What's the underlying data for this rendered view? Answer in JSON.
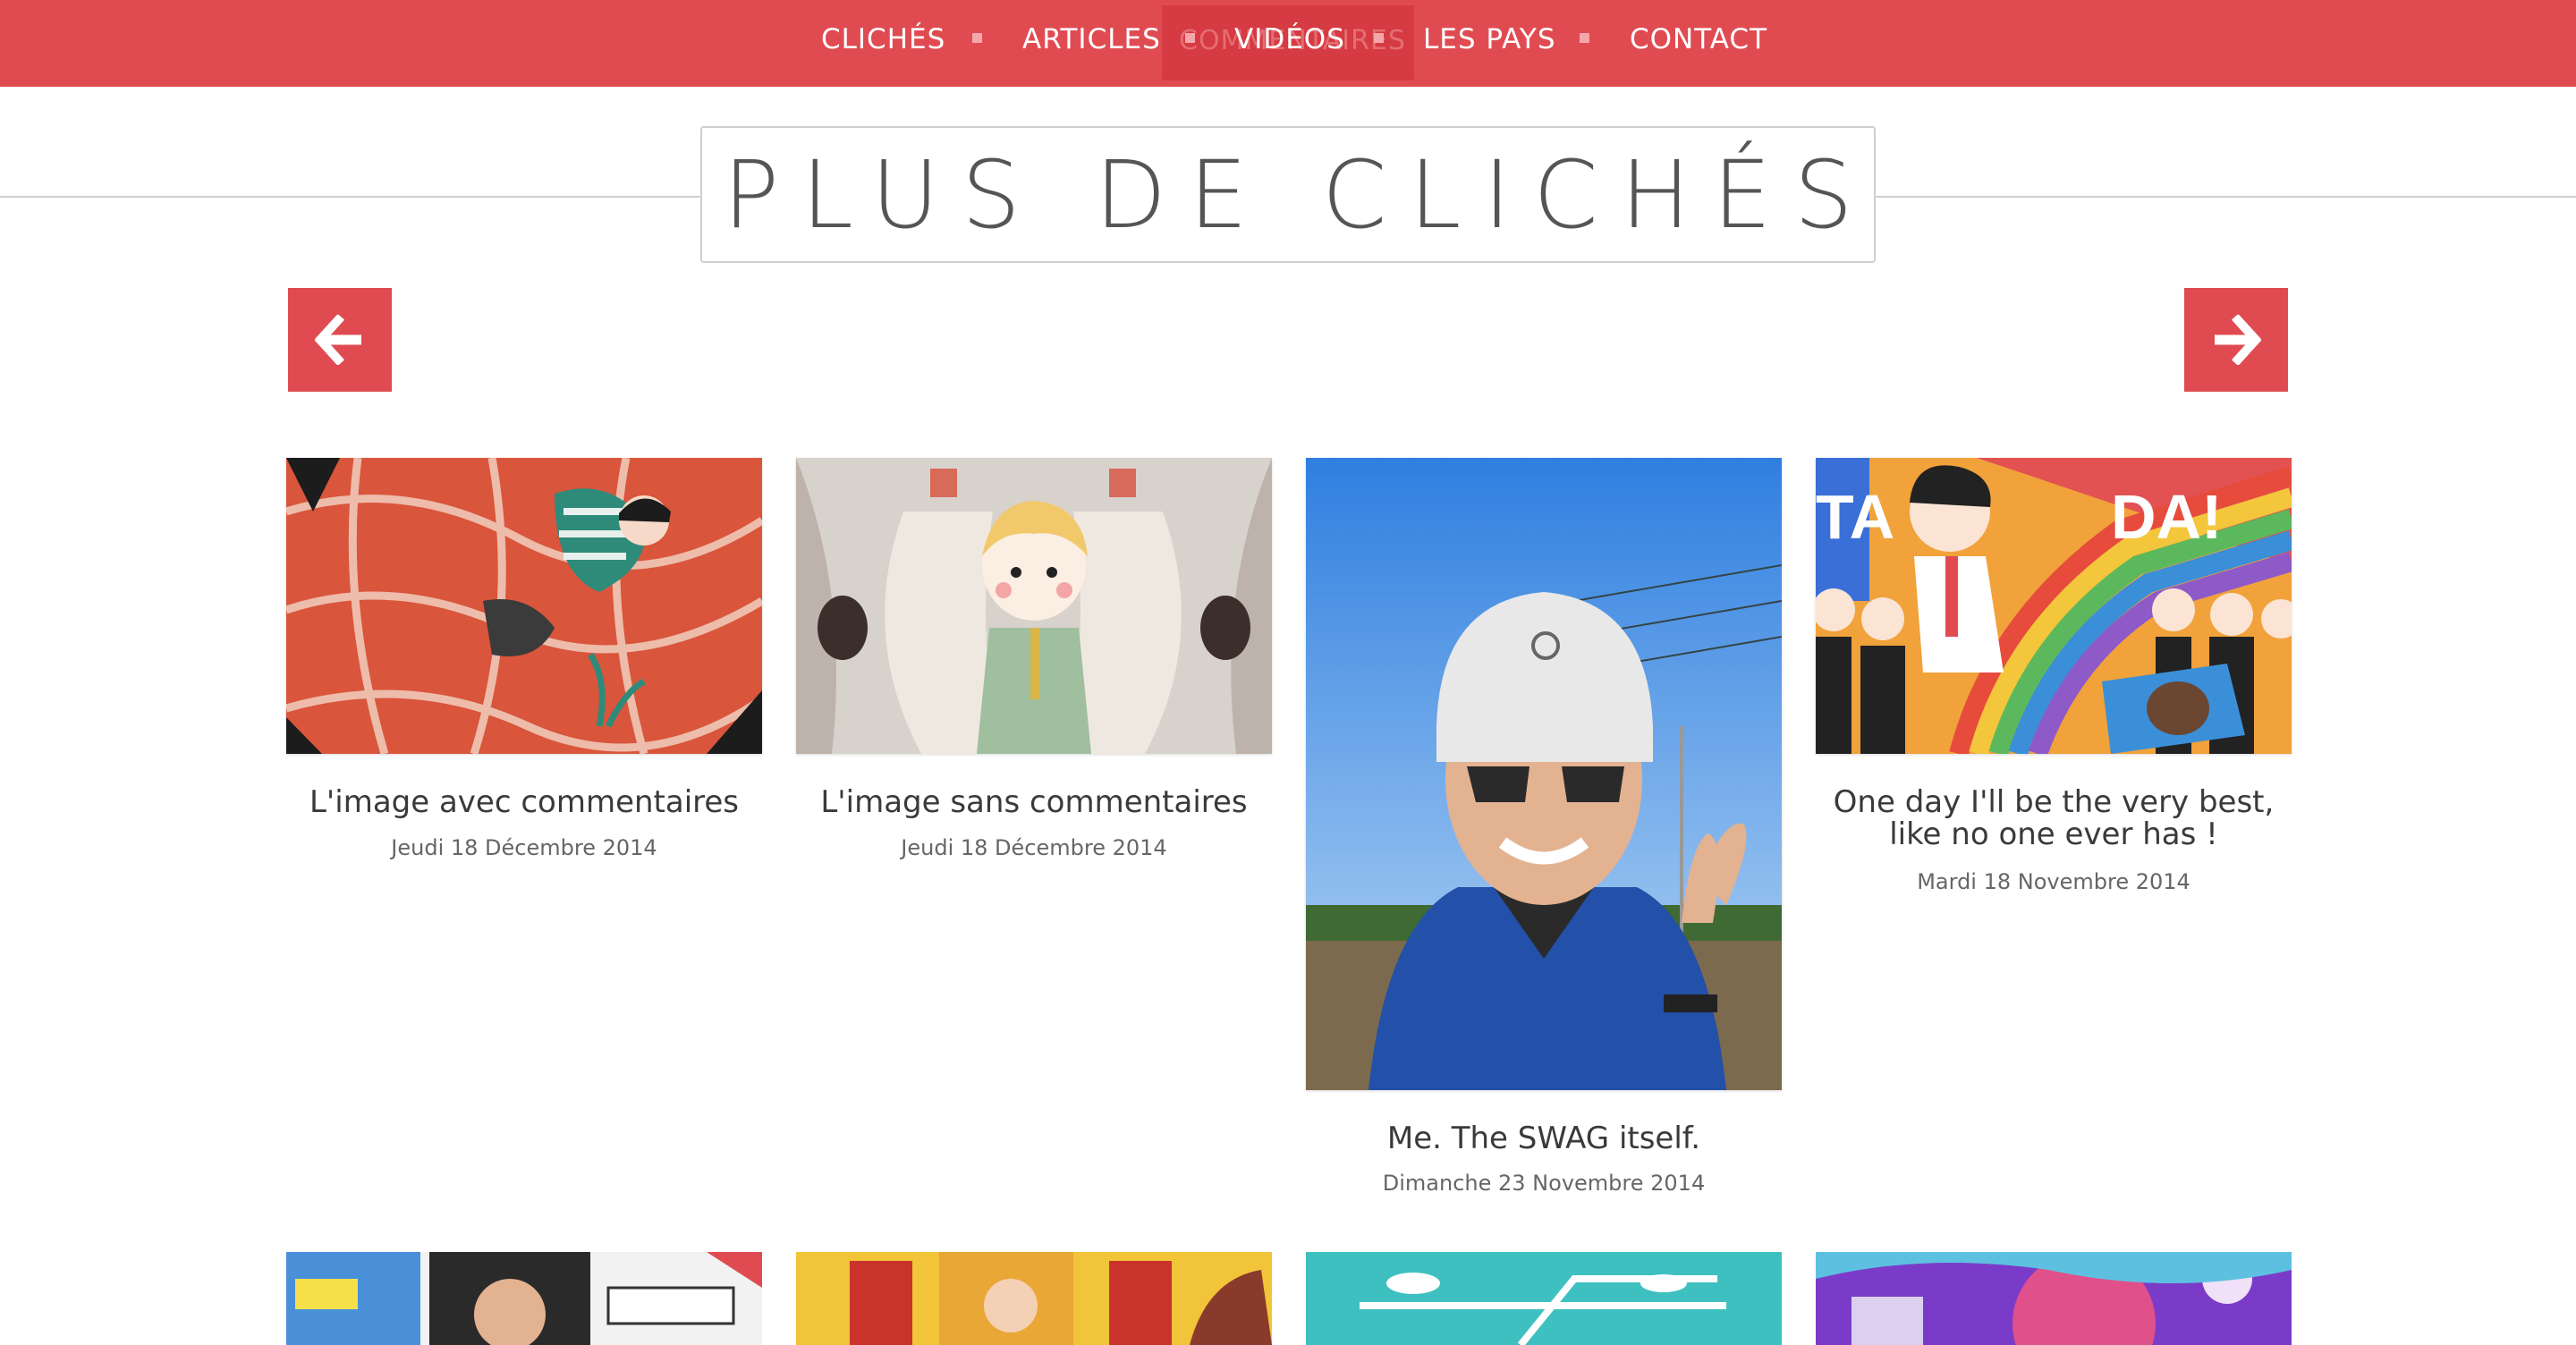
{
  "nav": {
    "items": [
      "CLICHÉS",
      "ARTICLES",
      "VIDÉOS",
      "LES PAYS",
      "CONTACT"
    ],
    "ghost_label": "COMMENTAIRES"
  },
  "page_title": "PLUS DE CLICHÉS",
  "arrows": {
    "prev_icon": "arrow-left-icon",
    "next_icon": "arrow-right-icon"
  },
  "colors": {
    "accent": "#e04b52",
    "accent_dark": "#d63a42"
  },
  "cards": [
    {
      "title": "L'image avec commentaires",
      "date": "Jeudi 18 Décembre 2014",
      "image": "illustration-person-falling-in-red-web"
    },
    {
      "title": "L'image sans commentaires",
      "date": "Jeudi 18 Décembre 2014",
      "image": "illustration-reporter-cartoon"
    },
    {
      "title": "Me. The SWAG itself.",
      "date": "Dimanche 23 Novembre 2014",
      "image": "photo-selfie-helmet"
    },
    {
      "title": "One day I'll be the very best, like no one ever has !",
      "date": "Mardi 18 Novembre 2014",
      "image": "illustration-rainbow-tada"
    },
    {
      "image": "illustration-comic-hiring"
    },
    {
      "image": "illustration-yellow-poster"
    },
    {
      "image": "illustration-teal-landscape"
    },
    {
      "image": "illustration-purple-colorful"
    }
  ]
}
